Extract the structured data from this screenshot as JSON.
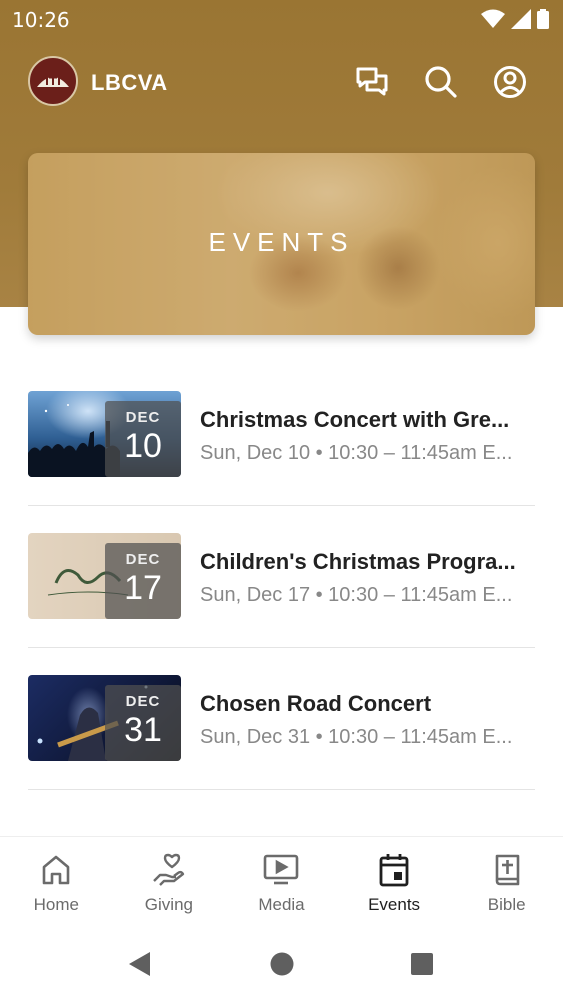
{
  "status_bar": {
    "time": "10:26"
  },
  "app_bar": {
    "title": "LBCVA"
  },
  "banner": {
    "title": "EVENTS"
  },
  "events": [
    {
      "month": "DEC",
      "day": "10",
      "title": "Christmas Concert with Gre...",
      "subtitle": "Sun, Dec 10 • 10:30 – 11:45am E..."
    },
    {
      "month": "DEC",
      "day": "17",
      "title": "Children's Christmas Progra...",
      "subtitle": "Sun, Dec 17 • 10:30 – 11:45am E..."
    },
    {
      "month": "DEC",
      "day": "31",
      "title": "Chosen Road Concert",
      "subtitle": "Sun, Dec 31 • 10:30 – 11:45am E..."
    }
  ],
  "bottom_nav": [
    {
      "label": "Home",
      "icon": "home-icon",
      "active": false
    },
    {
      "label": "Giving",
      "icon": "giving-icon",
      "active": false
    },
    {
      "label": "Media",
      "icon": "media-icon",
      "active": false
    },
    {
      "label": "Events",
      "icon": "calendar-icon",
      "active": true
    },
    {
      "label": "Bible",
      "icon": "bible-icon",
      "active": false
    }
  ],
  "colors": {
    "brand": "#9a7533",
    "active": "#1f1f1f",
    "inactive": "#6b6b6b"
  }
}
